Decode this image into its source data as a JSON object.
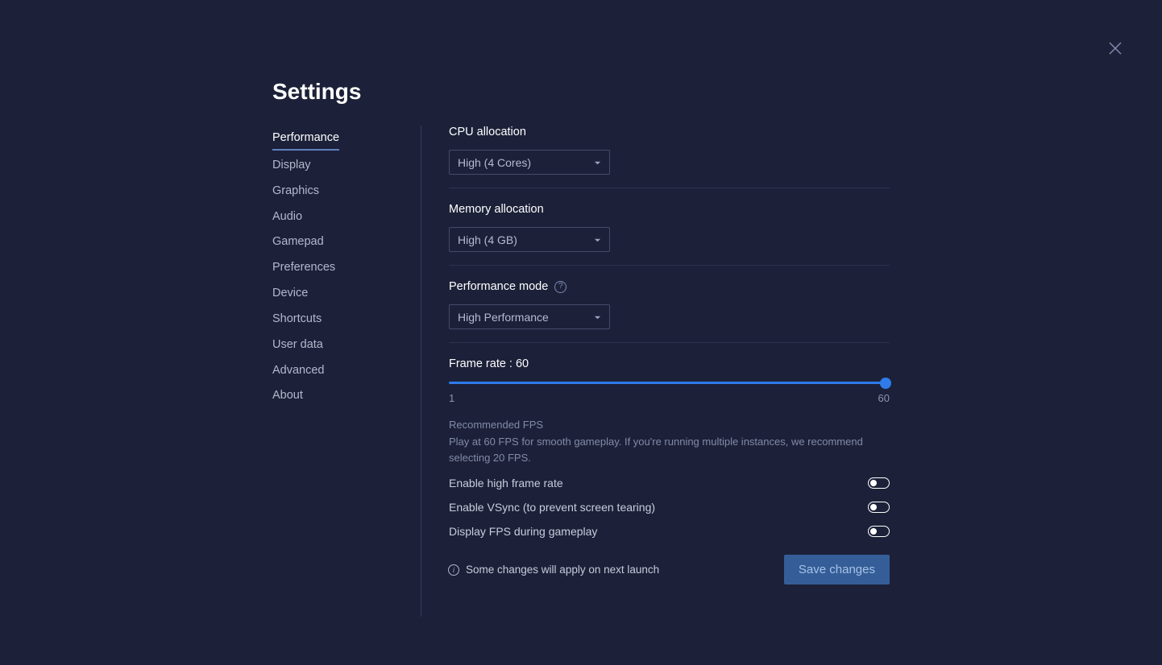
{
  "title": "Settings",
  "sidebar": {
    "items": [
      {
        "label": "Performance",
        "active": true
      },
      {
        "label": "Display"
      },
      {
        "label": "Graphics"
      },
      {
        "label": "Audio"
      },
      {
        "label": "Gamepad"
      },
      {
        "label": "Preferences"
      },
      {
        "label": "Device"
      },
      {
        "label": "Shortcuts"
      },
      {
        "label": "User data"
      },
      {
        "label": "Advanced"
      },
      {
        "label": "About"
      }
    ]
  },
  "fields": {
    "cpu": {
      "label": "CPU allocation",
      "value": "High (4 Cores)"
    },
    "memory": {
      "label": "Memory allocation",
      "value": "High (4 GB)"
    },
    "perf_mode": {
      "label": "Performance mode",
      "value": "High Performance"
    },
    "framerate": {
      "label": "Frame rate : 60",
      "min": "1",
      "max": "60",
      "value": 60,
      "hint_title": "Recommended FPS",
      "hint_text": "Play at 60 FPS for smooth gameplay. If you're running multiple instances, we recommend selecting 20 FPS."
    },
    "toggles": {
      "high_fps": {
        "label": "Enable high frame rate",
        "on": false
      },
      "vsync": {
        "label": "Enable VSync (to prevent screen tearing)",
        "on": false
      },
      "display_fps": {
        "label": "Display FPS during gameplay",
        "on": false
      }
    }
  },
  "footer": {
    "note": "Some changes will apply on next launch",
    "save": "Save changes"
  }
}
